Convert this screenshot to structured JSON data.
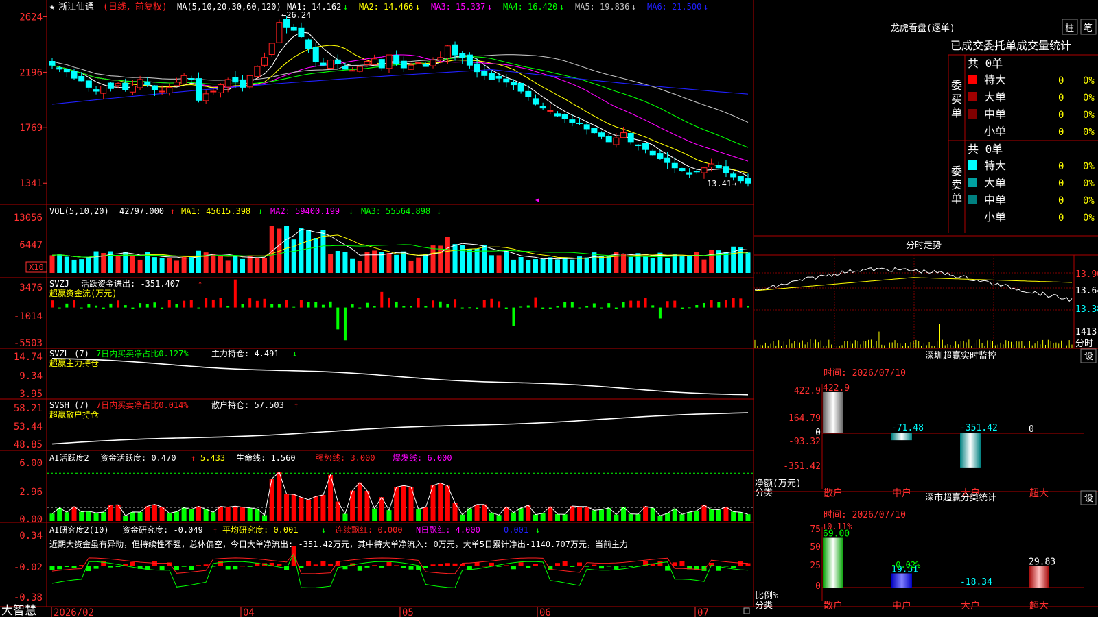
{
  "colors": {
    "up": "#ff2020",
    "down": "#00ffff",
    "green": "#00ff00",
    "red": "#ff0000",
    "border": "#c00000",
    "ma1": "#ffffff",
    "ma2": "#ffff00",
    "ma3": "#ff00ff",
    "ma4": "#00ff00",
    "ma5": "#c0c0c0",
    "ma6": "#2020ff"
  },
  "app": {
    "brand": "大智慧"
  },
  "main_chart": {
    "title_star": "★",
    "stock_name": "浙江仙通",
    "period": "(日线，前复权)",
    "ma_params": "MA(5,10,20,30,60,120)",
    "ma": [
      {
        "label": "MA1:",
        "value": "14.162",
        "arrow": "↓"
      },
      {
        "label": "MA2:",
        "value": "14.466",
        "arrow": "↓"
      },
      {
        "label": "MA3:",
        "value": "15.337",
        "arrow": "↓"
      },
      {
        "label": "MA4:",
        "value": "16.420",
        "arrow": "↓"
      },
      {
        "label": "MA5:",
        "value": "19.836",
        "arrow": "↓"
      },
      {
        "label": "MA6:",
        "value": "21.500",
        "arrow": "↓"
      }
    ],
    "y_ticks": [
      "2624",
      "2196",
      "1769",
      "1341"
    ],
    "high_label": "←26.24",
    "low_label": "13.41→"
  },
  "vol_panel": {
    "header": "VOL(5,10,20)",
    "value": "42797.000",
    "arrow": "↑",
    "ma1": "MA1: 45615.398",
    "ma1_arrow": "↓",
    "ma2": "MA2: 59400.199",
    "ma2_arrow": "↓",
    "ma3": "MA3: 55564.898",
    "ma3_arrow": "↓",
    "y_ticks": [
      "13056",
      "6447"
    ],
    "unit": "X10"
  },
  "svzj_panel": {
    "header": "SVZJ",
    "name": "活跃资金进出: -351.407",
    "arrow": "↑",
    "subtitle": "超赢资金流(万元)",
    "y_ticks": [
      "3476",
      "-1014",
      "-5503"
    ]
  },
  "svzl_panel": {
    "header": "SVZL (7)",
    "ratio": "7日内买卖净占比0.127%",
    "hold": "主力持仓: 4.491",
    "arrow": "↓",
    "subtitle": "超赢主力持仓",
    "y_ticks": [
      "14.74",
      "9.34",
      "3.95"
    ]
  },
  "svsh_panel": {
    "header": "SVSH (7)",
    "ratio": "7日内买卖净占比0.014%",
    "hold": "散户持仓: 57.503",
    "arrow": "↑",
    "subtitle": "超赢散户持仓",
    "y_ticks": [
      "58.21",
      "53.44",
      "48.85"
    ]
  },
  "ai_active_panel": {
    "header": "AI活跃度2",
    "a": "资金活跃度: 0.470",
    "a_arrow": "↑",
    "b": "5.433",
    "c": "生命线: 1.560",
    "d": "强势线: 3.000",
    "e": "爆发线: 6.000",
    "y_ticks": [
      "6.00",
      "2.96",
      "0.00"
    ]
  },
  "ai_research_panel": {
    "header": "AI研究度2(10)",
    "a": "资金研究度: -0.049",
    "a_arrow": "↑",
    "b": "平均研究度: 0.001",
    "b_arrow": "↓",
    "c": "连续飘红: 0.000",
    "d": "N日飘红: 4.000",
    "e": "0.001",
    "e_arrow": "↓",
    "comment": "近期大资金虽有异动，但持续性不强，总体偏空，今日大单净流出: -351.42万元，其中特大单净流入: 0万元，大单5日累计净出-1140.707万元，当前主力",
    "y_ticks": [
      "0.34",
      "-0.02",
      "-0.38"
    ]
  },
  "x_axis": {
    "labels": [
      "2026/02",
      "04",
      "05",
      "06",
      "07"
    ]
  },
  "right": {
    "lhb": {
      "title": "龙虎看盘(逐单)",
      "btn1": "柱",
      "btn2": "笔",
      "subtitle": "已成交委托单成交量统计",
      "buy": {
        "label": "委买单",
        "total": "共 0单",
        "rows": [
          {
            "name": "特大",
            "count": "0",
            "pct": "0%",
            "color": "#ff0000"
          },
          {
            "name": "大单",
            "count": "0",
            "pct": "0%",
            "color": "#a00000"
          },
          {
            "name": "中单",
            "count": "0",
            "pct": "0%",
            "color": "#800000"
          },
          {
            "name": "小单",
            "count": "0",
            "pct": "0%",
            "color": "#000000"
          }
        ]
      },
      "sell": {
        "label": "委卖单",
        "total": "共 0单",
        "rows": [
          {
            "name": "特大",
            "count": "0",
            "pct": "0%",
            "color": "#00ffff"
          },
          {
            "name": "大单",
            "count": "0",
            "pct": "0%",
            "color": "#00a0a0"
          },
          {
            "name": "中单",
            "count": "0",
            "pct": "0%",
            "color": "#008080"
          },
          {
            "name": "小单",
            "count": "0",
            "pct": "0%",
            "color": "#000000"
          }
        ]
      }
    },
    "intraday": {
      "title": "分时走势",
      "y_ticks": [
        "13.90",
        "13.64",
        "13.38"
      ],
      "vol_tick": "1413",
      "vol_label": "分时"
    },
    "monitor": {
      "title": "深圳超赢实时监控",
      "btn": "设",
      "time": "时间: 2026/07/10",
      "y_ticks": [
        "422.9",
        "164.79",
        "0",
        "-93.32",
        "-351.42"
      ],
      "unit": "净额(万元)",
      "cat_label": "分类",
      "categories": [
        "散户",
        "中户",
        "大户",
        "超大"
      ],
      "values": [
        422.9,
        -71.48,
        -351.42,
        0
      ],
      "value_labels": [
        "422.9",
        "-71.48",
        "-351.42",
        "0"
      ]
    },
    "classify": {
      "title": "深市超赢分类统计",
      "btn": "设",
      "time": "时间: 2026/07/10",
      "y_ticks": [
        "75",
        "50",
        "25",
        "0"
      ],
      "unit": "比例%",
      "cat_label": "分类",
      "categories": [
        "散户",
        "中户",
        "大户",
        "超大"
      ],
      "values": [
        69.0,
        19.51,
        -18.34,
        29.83
      ],
      "value_labels": [
        "69.00",
        "19.51",
        "-18.34",
        "29.83"
      ],
      "top_labels": [
        "+0.11%",
        "-0.02%"
      ]
    }
  },
  "chart_data": [
    {
      "type": "candlestick",
      "title": "浙江仙通 (日线，前复权)",
      "ylim": [
        13.0,
        27.0
      ],
      "x": [
        "2026/02",
        "04",
        "05",
        "06",
        "07"
      ],
      "close_series": [
        22.5,
        22.2,
        22.0,
        21.5,
        21.3,
        20.8,
        20.5,
        20.9,
        20.7,
        21.1,
        20.6,
        20.9,
        21.4,
        21.0,
        20.6,
        20.5,
        20.8,
        21.2,
        21.7,
        21.4,
        19.8,
        20.3,
        20.5,
        21.0,
        21.4,
        21.2,
        20.8,
        21.7,
        22.4,
        23.1,
        24.2,
        25.8,
        25.4,
        25.2,
        24.7,
        23.8,
        22.8,
        22.5,
        22.9,
        22.6,
        22.2,
        22.1,
        22.4,
        22.8,
        23.0,
        22.3,
        23.3,
        22.6,
        22.3,
        22.5,
        22.7,
        22.4,
        22.9,
        23.1,
        24.0,
        23.3,
        23.1,
        22.5,
        22.0,
        21.7,
        21.4,
        21.5,
        21.2,
        21.0,
        20.5,
        20.1,
        19.5,
        19.2,
        19.0,
        18.6,
        18.4,
        18.1,
        18.0,
        17.6,
        17.3,
        17.0,
        16.6,
        16.9,
        17.3,
        16.6,
        16.3,
        16.0,
        15.6,
        15.3,
        15.0,
        14.6,
        14.4,
        14.1,
        14.3,
        14.6,
        14.9,
        14.6,
        14.2,
        13.9,
        13.6,
        13.41
      ]
    }
  ]
}
